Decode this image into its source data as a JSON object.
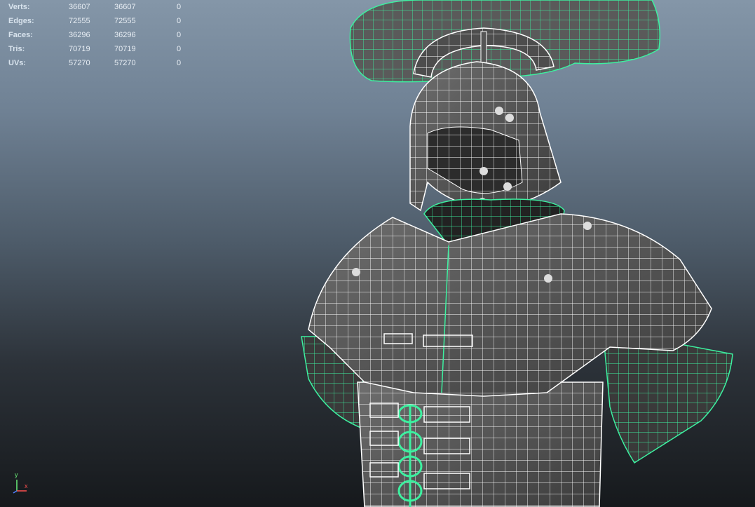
{
  "hud": {
    "rows": [
      {
        "label": "Verts:",
        "a": "36607",
        "b": "36607",
        "c": "0"
      },
      {
        "label": "Edges:",
        "a": "72555",
        "b": "72555",
        "c": "0"
      },
      {
        "label": "Faces:",
        "a": "36296",
        "b": "36296",
        "c": "0"
      },
      {
        "label": "Tris:",
        "a": "70719",
        "b": "70719",
        "c": "0"
      },
      {
        "label": "UVs:",
        "a": "57270",
        "b": "57270",
        "c": "0"
      }
    ]
  },
  "axis": {
    "y": "y",
    "x": "x"
  },
  "colors": {
    "wire": "#ffffff",
    "selected_wire": "#3df0a0",
    "mesh": "#5c5c5c"
  }
}
